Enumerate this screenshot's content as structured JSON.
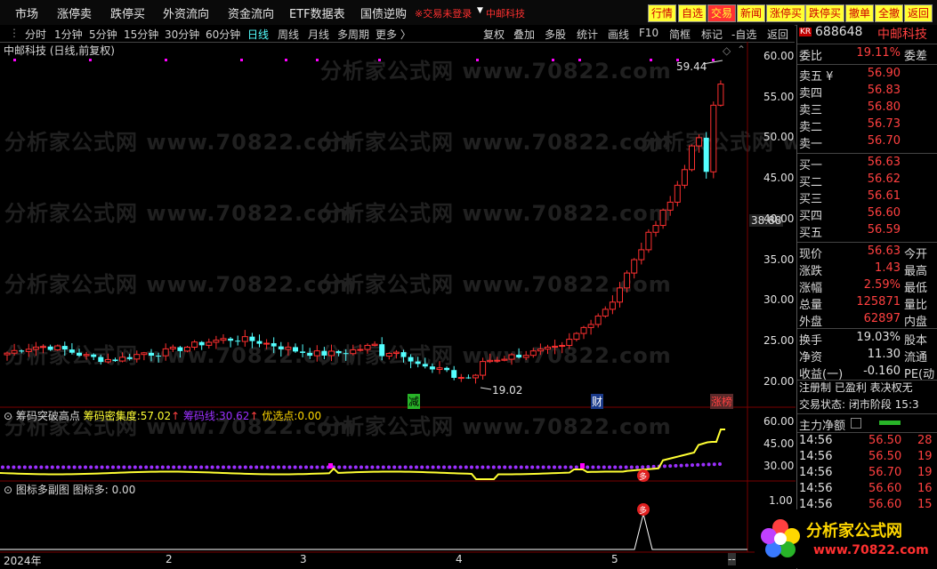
{
  "menu": {
    "items": [
      "市场",
      "涨停卖",
      "跌停买",
      "外资流向",
      "资金流向",
      "ETF数据表",
      "国债逆购"
    ],
    "warning": "※交易未登录",
    "stock_tab": "中邮科技",
    "buttons": [
      "行情",
      "自选",
      "交易",
      "新闻",
      "涨停买",
      "跌停买",
      "撤单",
      "全撤",
      "返回"
    ]
  },
  "toolbar": {
    "periods": [
      "分时",
      "1分钟",
      "5分钟",
      "15分钟",
      "30分钟",
      "60分钟",
      "日线",
      "周线",
      "月线",
      "多周期",
      "更多 〉"
    ],
    "active_period": "日线",
    "tools": [
      "复权",
      "叠加",
      "多股",
      "统计",
      "画线",
      "F10",
      "简框",
      "标记",
      "-自选",
      "返回"
    ]
  },
  "main_chart": {
    "title": "中邮科技 (日线,前复权)",
    "high_label": "59.44",
    "low_label": "19.02",
    "cursor_price": "38.88",
    "y_ticks": [
      "60.00",
      "55.00",
      "50.00",
      "45.00",
      "40.00",
      "35.00",
      "30.00",
      "25.00",
      "20.00"
    ],
    "markers": [
      "减",
      "财",
      "涨榜"
    ],
    "watermark": "分析家公式网 www.70822.com"
  },
  "indicator1": {
    "name": "筹码突破高点",
    "items": [
      {
        "label": "筹码密集度:",
        "value": "57.02",
        "color": "#ffff33"
      },
      {
        "label": "筹码线:",
        "value": "30.62",
        "color": "#9b30ff"
      },
      {
        "label": "优选点:",
        "value": "0.00",
        "color": "#ffd700"
      }
    ],
    "y_ticks": [
      "60.00",
      "45.00",
      "30.00"
    ],
    "signal": "多"
  },
  "indicator2": {
    "name": "图标多副图",
    "label": "图标多:",
    "value": "0.00",
    "y_ticks": [
      "1.00"
    ],
    "signal": "多"
  },
  "x_axis": [
    "2024年",
    "2",
    "3",
    "4",
    "5",
    "--"
  ],
  "right_panel": {
    "market_badge": "KR",
    "code": "688648",
    "name": "中邮科技",
    "weibi_label": "委比",
    "weibi_value": "19.11%",
    "weicha_label": "委差",
    "asks": [
      {
        "label": "卖五 ¥",
        "price": "56.90"
      },
      {
        "label": "卖四",
        "price": "56.83"
      },
      {
        "label": "卖三",
        "price": "56.80"
      },
      {
        "label": "卖二",
        "price": "56.73"
      },
      {
        "label": "卖一",
        "price": "56.70"
      }
    ],
    "bids": [
      {
        "label": "买一",
        "price": "56.63"
      },
      {
        "label": "买二",
        "price": "56.62"
      },
      {
        "label": "买三",
        "price": "56.61"
      },
      {
        "label": "买四",
        "price": "56.60"
      },
      {
        "label": "买五",
        "price": "56.59"
      }
    ],
    "quote": [
      {
        "label": "现价",
        "value": "56.63",
        "right": "今开"
      },
      {
        "label": "涨跌",
        "value": "1.43",
        "right": "最高"
      },
      {
        "label": "涨幅",
        "value": "2.59%",
        "right": "最低"
      },
      {
        "label": "总量",
        "value": "125871",
        "right": "量比"
      },
      {
        "label": "外盘",
        "value": "62897",
        "right": "内盘"
      }
    ],
    "stats": [
      {
        "label": "换手",
        "value": "19.03%",
        "right": "股本"
      },
      {
        "label": "净资",
        "value": "11.30",
        "right": "流通"
      },
      {
        "label": "收益(一)",
        "value": "-0.160",
        "right": "PE(动"
      }
    ],
    "tags": "注册制 已盈利 表决权无",
    "status": "交易状态: 闭市阶段 15:3",
    "net_flow_label": "主力净额",
    "ticks": [
      {
        "time": "14:56",
        "price": "56.50",
        "vol": "28"
      },
      {
        "time": "14:56",
        "price": "56.50",
        "vol": "19"
      },
      {
        "time": "14:56",
        "price": "56.70",
        "vol": "19"
      },
      {
        "time": "14:56",
        "price": "56.60",
        "vol": "16"
      },
      {
        "time": "14:56",
        "price": "56.60",
        "vol": "15"
      }
    ],
    "logo_text": "分析家公式网",
    "logo_url": "www.70822.com"
  },
  "colors": {
    "up": "#ff3030",
    "down": "#54ffff",
    "yellow": "#ffff33",
    "purple": "#9b30ff",
    "magenta": "#ff00ff"
  }
}
